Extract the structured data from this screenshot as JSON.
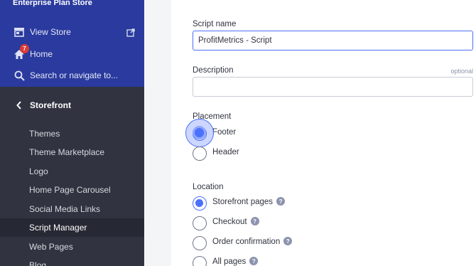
{
  "sidebar": {
    "store_name": "Enterprise Plan Store",
    "view_store": "View Store",
    "home": "Home",
    "home_badge": "7",
    "search": "Search or navigate to...",
    "section": "Storefront",
    "items": [
      {
        "label": "Themes"
      },
      {
        "label": "Theme Marketplace"
      },
      {
        "label": "Logo"
      },
      {
        "label": "Home Page Carousel"
      },
      {
        "label": "Social Media Links"
      },
      {
        "label": "Script Manager",
        "active": true
      },
      {
        "label": "Web Pages"
      },
      {
        "label": "Blog"
      }
    ]
  },
  "form": {
    "script_name_label": "Script name",
    "script_name_value": "ProfitMetrics - Script",
    "description_label": "Description",
    "description_optional": "optional",
    "description_value": "",
    "placement_label": "Placement",
    "placement_options": [
      {
        "label": "Footer",
        "checked": true
      },
      {
        "label": "Header",
        "checked": false
      }
    ],
    "location_label": "Location",
    "location_options": [
      {
        "label": "Storefront pages",
        "checked": true
      },
      {
        "label": "Checkout",
        "checked": false
      },
      {
        "label": "Order confirmation",
        "checked": false
      },
      {
        "label": "All pages",
        "checked": false
      }
    ],
    "help_glyph": "?"
  },
  "colors": {
    "sidebar_top": "#2a3a9e",
    "sidebar": "#313440",
    "accent": "#4b71fc",
    "badge": "#d93a36"
  }
}
